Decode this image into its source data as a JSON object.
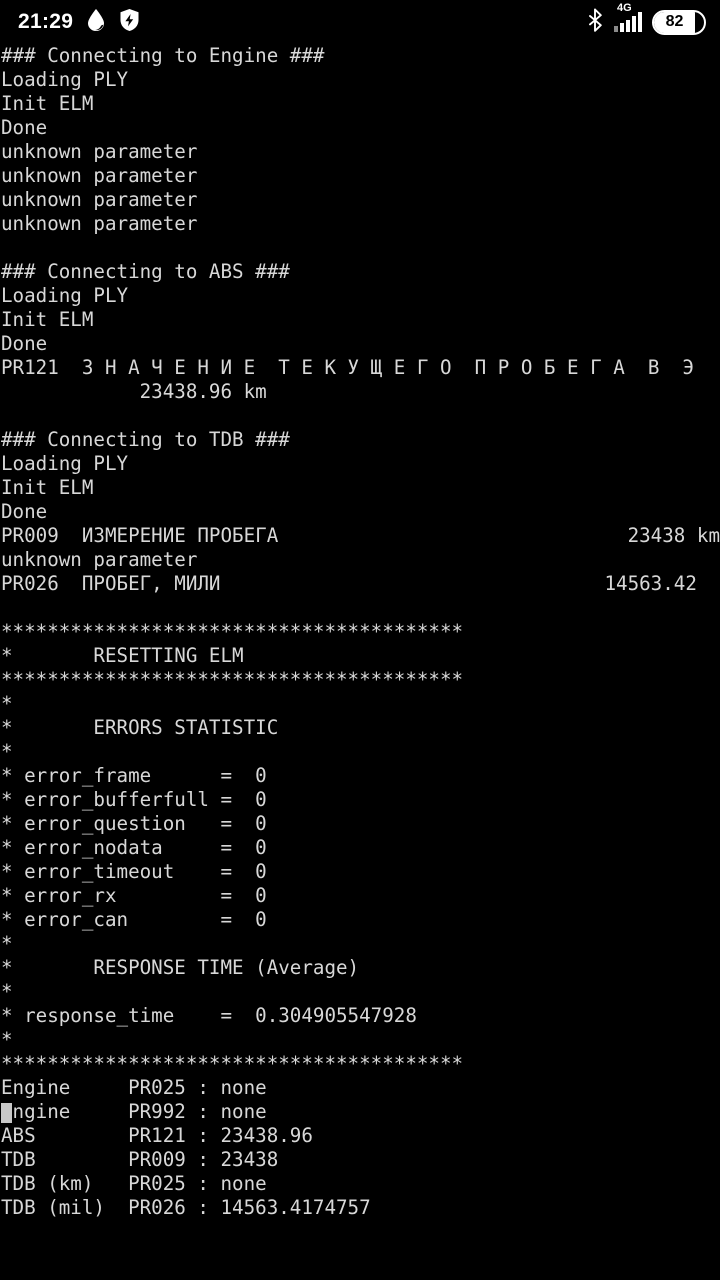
{
  "status_bar": {
    "clock": "21:29",
    "left_icons": [
      "water-drop-icon",
      "shield-security-icon"
    ],
    "right_icons": [
      "bluetooth-icon",
      "cellular-signal-icon"
    ],
    "network_label": "4G",
    "battery_percent": "82"
  },
  "terminal": {
    "background_color": "#000000",
    "text_color": "#d8d8d8",
    "cursor_color": "#c8c8c8",
    "cursor_line_index": 51,
    "lines": [
      {
        "text": "### Connecting to Engine ###"
      },
      {
        "text": "Loading PLY"
      },
      {
        "text": "Init ELM"
      },
      {
        "text": "Done"
      },
      {
        "text": "unknown parameter"
      },
      {
        "text": "unknown parameter"
      },
      {
        "text": "unknown parameter"
      },
      {
        "text": "unknown parameter"
      },
      {
        "text": ""
      },
      {
        "text": "### Connecting to ABS ###"
      },
      {
        "text": "Loading PLY"
      },
      {
        "text": "Init ELM"
      },
      {
        "text": "Done"
      },
      {
        "text": "PR121  З Н А Ч Е Н И Е  Т Е К У Щ Е Г О  П Р О Б Е Г А  В  Э"
      },
      {
        "text": "            23438.96 km"
      },
      {
        "text": ""
      },
      {
        "text": "### Connecting to TDB ###"
      },
      {
        "text": "Loading PLY"
      },
      {
        "text": "Init ELM"
      },
      {
        "text": "Done"
      },
      {
        "text": "PR009  ИЗМЕРЕНИЕ ПРОБЕГА",
        "right": "23438 km"
      },
      {
        "text": "unknown parameter"
      },
      {
        "text": "PR026  ПРОБЕГ, МИЛИ",
        "right": "14563.42  "
      },
      {
        "text": ""
      },
      {
        "text": "****************************************"
      },
      {
        "text": "*       RESETTING ELM"
      },
      {
        "text": "****************************************"
      },
      {
        "text": "*"
      },
      {
        "text": "*       ERRORS STATISTIC"
      },
      {
        "text": "*"
      },
      {
        "text": "* error_frame      =  0"
      },
      {
        "text": "* error_bufferfull =  0"
      },
      {
        "text": "* error_question   =  0"
      },
      {
        "text": "* error_nodata     =  0"
      },
      {
        "text": "* error_timeout    =  0"
      },
      {
        "text": "* error_rx         =  0"
      },
      {
        "text": "* error_can        =  0"
      },
      {
        "text": "*"
      },
      {
        "text": "*       RESPONSE TIME (Average)"
      },
      {
        "text": "*"
      },
      {
        "text": "* response_time    =  0.304905547928"
      },
      {
        "text": "*"
      },
      {
        "text": "****************************************"
      },
      {
        "text": "Engine     PR025 : none"
      },
      {
        "text": "Engine     PR992 : none",
        "cursor": true
      },
      {
        "text": "ABS        PR121 : 23438.96"
      },
      {
        "text": "TDB        PR009 : 23438"
      },
      {
        "text": "TDB (km)   PR025 : none"
      },
      {
        "text": "TDB (mil)  PR026 : 14563.4174757"
      }
    ]
  }
}
